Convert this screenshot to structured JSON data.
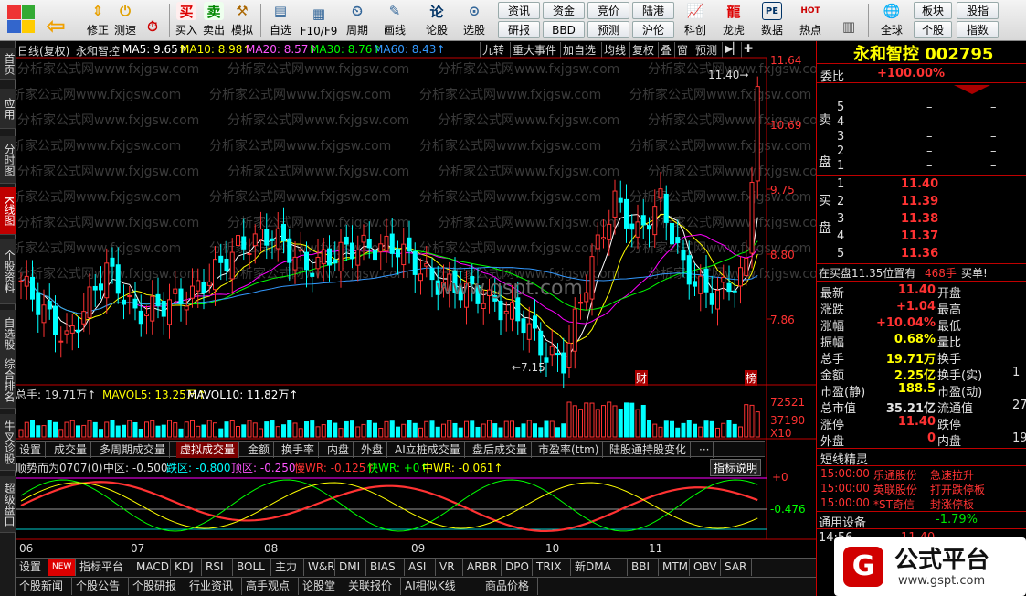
{
  "toolbar": {
    "buttons": [
      "修正",
      "测速",
      "买入",
      "卖出",
      "模拟",
      "自选",
      "F10/F9",
      "周期",
      "画线",
      "论股",
      "选股",
      "科创",
      "龙虎",
      "数据",
      "热点",
      "全球",
      "个股",
      "指数"
    ],
    "small_buttons": [
      "资讯",
      "研报",
      "资金",
      "BBD",
      "竞价",
      "预测",
      "陆港",
      "沪伦",
      "板块",
      "股指",
      "股指"
    ],
    "small": {
      "a": "资讯",
      "b": "研报",
      "c": "资金",
      "d": "BBD",
      "e": "竞价",
      "f": "预测",
      "g": "陆港",
      "h": "沪伦",
      "i": "板块",
      "j": "股指",
      "k": "个股",
      "l": "指数",
      "m": "全球"
    }
  },
  "left_tabs": [
    "首页",
    "应用",
    "分时图",
    "K线图",
    "个股资料",
    "自选股",
    "综合排名",
    "牛叉诊股",
    "超级盘口"
  ],
  "chart_header": {
    "period": "日线(复权)",
    "stock": "永和智控",
    "ma5": "MA5: 9.65↑",
    "ma10": "MA10: 8.98↑",
    "ma20": "MA20: 8.57↑",
    "ma30": "MA30: 8.76↑",
    "ma60": "MA60: 8.43↑",
    "buttons": [
      "九转",
      "重大事件",
      "加自选",
      "均线",
      "复权",
      "叠",
      "窗",
      "预测"
    ]
  },
  "watermark": "分析家公式网www.fxjgsw.com",
  "site_watermark": "www.gspt.com",
  "price_axis": [
    "11.64",
    "10.69",
    "9.75",
    "8.80",
    "7.86"
  ],
  "annotations": {
    "high": "11.40→",
    "low": "←7.15",
    "cai": "财",
    "bang": "榜"
  },
  "volume": {
    "label": "总手: 19.71万↑",
    "mavol5": "MAVOL5: 13.25万↑",
    "mavol10": "MAVOL10: 11.82万↑",
    "axis": [
      "72521",
      "37190",
      "X10"
    ]
  },
  "sub_tabs": [
    "设置",
    "成交量",
    "多周期成交量",
    "虚拟成交量",
    "金额",
    "换手率",
    "内盘",
    "外盘",
    "AI立桩成交量",
    "盘后成交量",
    "市盈率(ttm)",
    "陆股通持股变化",
    "···"
  ],
  "indicator": {
    "title": "顺势而为0707(0)",
    "mid": "中区: -0.500",
    "fall": "跌区: -0.800",
    "top": "顶区: -0.250",
    "slow": "慢WR: -0.125↑",
    "fast": "快WR: +0↑",
    "midwr": "中WR: -0.061↑",
    "help": "指标说明",
    "axis": [
      "+0",
      "-0.476"
    ]
  },
  "months": [
    "06",
    "07",
    "08",
    "09",
    "10",
    "11"
  ],
  "bottom_row1": [
    "设置",
    "NEW",
    "指标平台",
    "MACD",
    "KDJ",
    "RSI",
    "BOLL",
    "主力",
    "W&R",
    "DMI",
    "BIAS",
    "ASI",
    "VR",
    "ARBR",
    "DPO",
    "TRIX",
    "新DMA",
    "BBI",
    "MTM",
    "OBV",
    "SAR"
  ],
  "bottom_row2": [
    "个股新闻",
    "个股公告",
    "个股研报",
    "行业资讯",
    "高手观点",
    "论股堂",
    "关联报价",
    "AI相似K线",
    "商品价格"
  ],
  "right_panel": {
    "title": "永和智控 002795",
    "weibi_label": "委比",
    "weibi": "+100.00%",
    "sell_label": "卖盘",
    "buy_label": "买盘",
    "sell": [
      {
        "n": "5",
        "p": "–"
      },
      {
        "n": "4",
        "p": "–"
      },
      {
        "n": "3",
        "p": "–"
      },
      {
        "n": "2",
        "p": "–"
      },
      {
        "n": "1",
        "p": "–"
      }
    ],
    "buy": [
      {
        "n": "1",
        "p": "11.40"
      },
      {
        "n": "2",
        "p": "11.39"
      },
      {
        "n": "3",
        "p": "11.38"
      },
      {
        "n": "4",
        "p": "11.37"
      },
      {
        "n": "5",
        "p": "11.36"
      }
    ],
    "outer_line": "在买盘11.35位置有",
    "outer_qty": "468手",
    "outer_tag": "买单!",
    "stats": [
      {
        "l": "最新",
        "v": "11.40",
        "l2": "开盘"
      },
      {
        "l": "涨跌",
        "v": "+1.04",
        "l2": "最高"
      },
      {
        "l": "涨幅",
        "v": "+10.04%",
        "l2": "最低"
      },
      {
        "l": "振幅",
        "v": "0.68%",
        "l2": "量比"
      },
      {
        "l": "总手",
        "v": "19.71万",
        "l2": "换手"
      },
      {
        "l": "金额",
        "v": "2.25亿",
        "l2": "换手(实)"
      },
      {
        "l": "市盈(静)",
        "v": "188.5",
        "l2": "市盈(动)"
      },
      {
        "l": "总市值",
        "v": "35.21亿",
        "l2": "流通值"
      },
      {
        "l": "涨停",
        "v": "11.40",
        "l2": "跌停"
      },
      {
        "l": "外盘",
        "v": "0",
        "l2": "内盘"
      }
    ],
    "cut_values": [
      "1",
      "27",
      "19"
    ],
    "short_title": "短线精灵",
    "short": [
      {
        "t": "15:00:00",
        "s": "乐通股份",
        "e": "急速拉升"
      },
      {
        "t": "15:00:00",
        "s": "英联股份",
        "e": "打开跌停板"
      },
      {
        "t": "15:00:00",
        "s": "*ST奇信",
        "e": "封涨停板"
      }
    ],
    "device_label": "通用设备",
    "device_val": "-1.79%",
    "partial": [
      "14:56",
      "11.40"
    ]
  },
  "logo": {
    "text": "公式平台",
    "url": "www.gspt.com"
  },
  "colors": {
    "up": "#ff3232",
    "down": "#00ffff",
    "ma5": "#ffffff",
    "ma10": "#ffff00",
    "ma20": "#ff00ff",
    "ma30": "#00ff00",
    "ma60": "#3399ff"
  }
}
